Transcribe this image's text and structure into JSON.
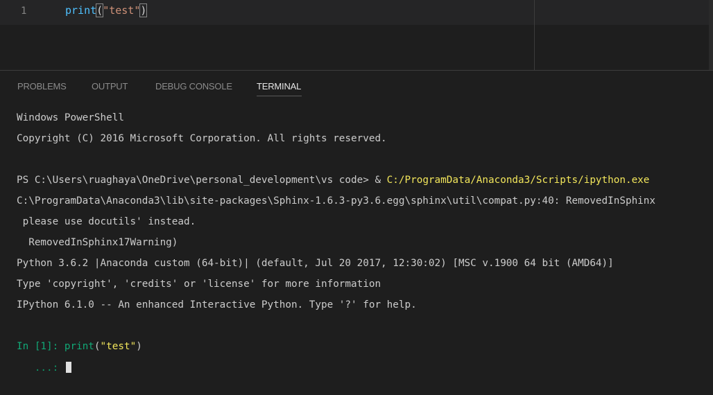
{
  "editor": {
    "line_number": "1",
    "code": {
      "fn": "print",
      "open": "(",
      "str": "\"test\"",
      "close": ")"
    }
  },
  "panel": {
    "tabs": [
      {
        "label": "PROBLEMS"
      },
      {
        "label": "OUTPUT"
      },
      {
        "label": "DEBUG CONSOLE"
      },
      {
        "label": "TERMINAL"
      }
    ],
    "active_tab": "TERMINAL"
  },
  "terminal": {
    "lines": [
      "Windows PowerShell",
      "Copyright (C) 2016 Microsoft Corporation. All rights reserved.",
      "",
      "C:\\ProgramData\\Anaconda3\\lib\\site-packages\\Sphinx-1.6.3-py3.6.egg\\sphinx\\util\\compat.py:40: RemovedInSphinx",
      " please use docutils' instead.",
      "  RemovedInSphinx17Warning)",
      "Python 3.6.2 |Anaconda custom (64-bit)| (default, Jul 20 2017, 12:30:02) [MSC v.1900 64 bit (AMD64)]",
      "Type 'copyright', 'credits' or 'license' for more information",
      "IPython 6.1.0 -- An enhanced Interactive Python. Type '?' for help."
    ],
    "ps_prompt": "PS C:\\Users\\ruaghaya\\OneDrive\\personal_development\\vs code> & ",
    "ps_command": "C:/ProgramData/Anaconda3/Scripts/ipython.exe",
    "in_prompt": "In [1]: ",
    "in_fn": "print",
    "in_open": "(",
    "in_str": "\"test\"",
    "in_close": ")",
    "continuation": "   ...: "
  },
  "colors": {
    "background": "#1e1e1e",
    "yellow": "#f2e65b",
    "green": "#11a876"
  }
}
